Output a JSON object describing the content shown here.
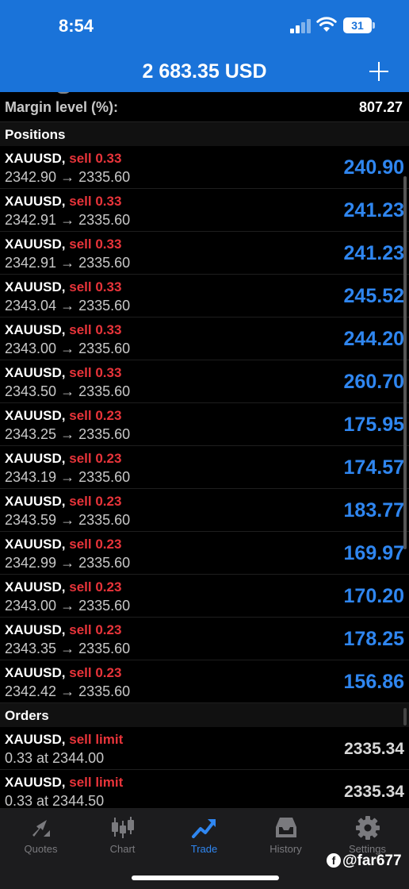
{
  "status": {
    "time": "8:54",
    "battery": "31"
  },
  "header": {
    "title": "2 683.35 USD"
  },
  "margin": {
    "label": "Margin level (%):",
    "value": "807.27"
  },
  "positions_header": "Positions",
  "positions": [
    {
      "symbol": "XAUUSD,",
      "type": "sell 0.33",
      "prices": "2342.90 → 2335.60",
      "profit": "240.90"
    },
    {
      "symbol": "XAUUSD,",
      "type": "sell 0.33",
      "prices": "2342.91 → 2335.60",
      "profit": "241.23"
    },
    {
      "symbol": "XAUUSD,",
      "type": "sell 0.33",
      "prices": "2342.91 → 2335.60",
      "profit": "241.23"
    },
    {
      "symbol": "XAUUSD,",
      "type": "sell 0.33",
      "prices": "2343.04 → 2335.60",
      "profit": "245.52"
    },
    {
      "symbol": "XAUUSD,",
      "type": "sell 0.33",
      "prices": "2343.00 → 2335.60",
      "profit": "244.20"
    },
    {
      "symbol": "XAUUSD,",
      "type": "sell 0.33",
      "prices": "2343.50 → 2335.60",
      "profit": "260.70"
    },
    {
      "symbol": "XAUUSD,",
      "type": "sell 0.23",
      "prices": "2343.25 → 2335.60",
      "profit": "175.95"
    },
    {
      "symbol": "XAUUSD,",
      "type": "sell 0.23",
      "prices": "2343.19 → 2335.60",
      "profit": "174.57"
    },
    {
      "symbol": "XAUUSD,",
      "type": "sell 0.23",
      "prices": "2343.59 → 2335.60",
      "profit": "183.77"
    },
    {
      "symbol": "XAUUSD,",
      "type": "sell 0.23",
      "prices": "2342.99 → 2335.60",
      "profit": "169.97"
    },
    {
      "symbol": "XAUUSD,",
      "type": "sell 0.23",
      "prices": "2343.00 → 2335.60",
      "profit": "170.20"
    },
    {
      "symbol": "XAUUSD,",
      "type": "sell 0.23",
      "prices": "2343.35 → 2335.60",
      "profit": "178.25"
    },
    {
      "symbol": "XAUUSD,",
      "type": "sell 0.23",
      "prices": "2342.42 → 2335.60",
      "profit": "156.86"
    }
  ],
  "orders_header": "Orders",
  "orders": [
    {
      "symbol": "XAUUSD,",
      "type": "sell limit",
      "detail": "0.33 at 2344.00",
      "price": "2335.34"
    },
    {
      "symbol": "XAUUSD,",
      "type": "sell limit",
      "detail": "0.33 at 2344.50",
      "price": "2335.34"
    }
  ],
  "tabs": [
    {
      "label": "Quotes",
      "icon": "quotes-icon",
      "active": false
    },
    {
      "label": "Chart",
      "icon": "candlestick-chart-icon",
      "active": false
    },
    {
      "label": "Trade",
      "icon": "trade-trend-icon",
      "active": true
    },
    {
      "label": "History",
      "icon": "history-inbox-icon",
      "active": false
    },
    {
      "label": "Settings",
      "icon": "gear-icon",
      "active": false
    }
  ],
  "watermark": {
    "icon": "facebook-icon",
    "text": "@far677"
  },
  "colors": {
    "header_blue": "#1a73d9",
    "sell_red": "#e8343a",
    "profit_blue": "#2f86f0",
    "tab_active": "#2f86f0",
    "tab_inactive": "#7a7a7e"
  }
}
